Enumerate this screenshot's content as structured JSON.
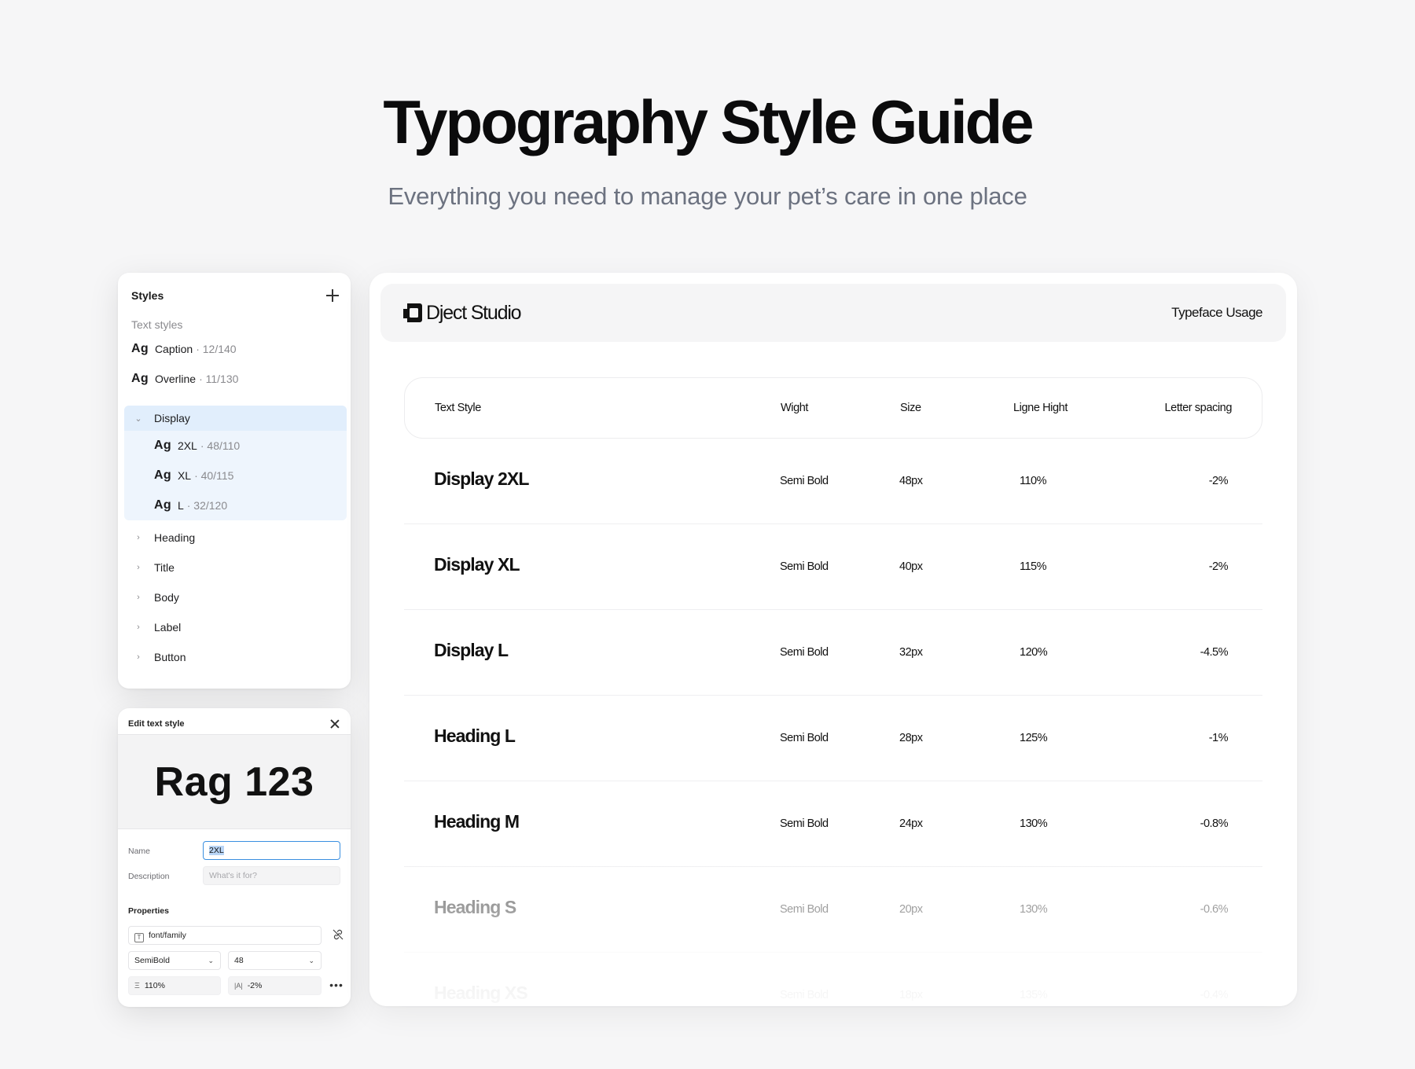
{
  "hero": {
    "title": "Typography Style Guide",
    "subtitle": "Everything you need to manage your pet’s care in one place"
  },
  "styles_panel": {
    "title": "Styles",
    "section_label": "Text styles",
    "items": [
      {
        "ag": "Ag",
        "name": "Caption",
        "meta": "· 12/140"
      },
      {
        "ag": "Ag",
        "name": "Overline",
        "meta": "· 11/130"
      }
    ],
    "group": {
      "name": "Display",
      "children": [
        {
          "ag": "Ag",
          "name": "2XL",
          "meta": "· 48/110"
        },
        {
          "ag": "Ag",
          "name": "XL",
          "meta": "· 40/115"
        },
        {
          "ag": "Ag",
          "name": "L",
          "meta": "· 32/120"
        }
      ]
    },
    "collapsed": [
      "Heading",
      "Title",
      "Body",
      "Label",
      "Button"
    ]
  },
  "edit_panel": {
    "title": "Edit text style",
    "preview": "Rag 123",
    "name_label": "Name",
    "name_value": "2XL",
    "description_label": "Description",
    "description_placeholder": "What's it for?",
    "properties_label": "Properties",
    "font_family": "font/family",
    "weight": "SemiBold",
    "size": "48",
    "line_height": "110%",
    "letter_spacing": "-2%"
  },
  "main": {
    "brand": "Dject Studio",
    "link": "Typeface Usage",
    "columns": [
      "Text Style",
      "Wight",
      "Size",
      "Ligne Hight",
      "Letter spacing"
    ],
    "rows": [
      {
        "name": "Display 2XL",
        "weight": "Semi Bold",
        "size": "48px",
        "line": "110%",
        "spacing": "-2%"
      },
      {
        "name": "Display XL",
        "weight": "Semi Bold",
        "size": "40px",
        "line": "115%",
        "spacing": "-2%"
      },
      {
        "name": "Display L",
        "weight": "Semi Bold",
        "size": "32px",
        "line": "120%",
        "spacing": "-4.5%"
      },
      {
        "name": "Heading L",
        "weight": "Semi Bold",
        "size": "28px",
        "line": "125%",
        "spacing": "-1%"
      },
      {
        "name": "Heading M",
        "weight": "Semi Bold",
        "size": "24px",
        "line": "130%",
        "spacing": "-0.8%"
      },
      {
        "name": "Heading S",
        "weight": "Semi Bold",
        "size": "20px",
        "line": "130%",
        "spacing": "-0.6%"
      },
      {
        "name": "Heading XS",
        "weight": "Semi Bold",
        "size": "18px",
        "line": "135%",
        "spacing": "-0.4%"
      }
    ]
  },
  "colors": {
    "accent": "#3a8fe0",
    "selected_bg": "#e1eefc",
    "group_bg": "#eef5fd"
  }
}
